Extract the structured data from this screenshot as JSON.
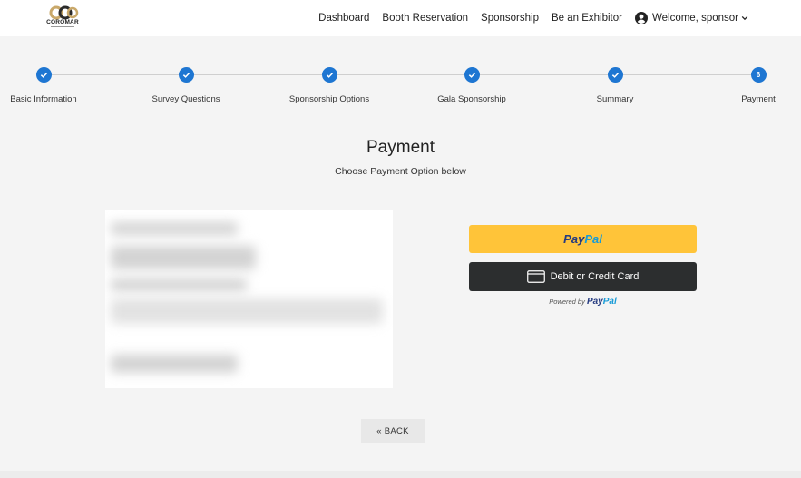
{
  "brand": {
    "name": "COROMAR",
    "logo_colors": {
      "ring1": "#c9a86a",
      "ring2": "#2b2b2b"
    }
  },
  "nav": {
    "items": [
      "Dashboard",
      "Booth Reservation",
      "Sponsorship",
      "Be an Exhibitor"
    ],
    "user_label": "Welcome, sponsor",
    "user_icon": "account-circle-icon",
    "menu_icon": "chevron-down-icon"
  },
  "stepper": {
    "steps": [
      {
        "label": "Basic Information",
        "status": "complete"
      },
      {
        "label": "Survey Questions",
        "status": "complete"
      },
      {
        "label": "Sponsorship Options",
        "status": "complete"
      },
      {
        "label": "Gala Sponsorship",
        "status": "complete"
      },
      {
        "label": "Summary",
        "status": "complete"
      },
      {
        "label": "Payment",
        "status": "current",
        "number": "6"
      }
    ],
    "accent_color": "#1e76d2"
  },
  "page": {
    "title": "Payment",
    "subtitle": "Choose Payment Option below"
  },
  "payment": {
    "paypal_part1": "Pay",
    "paypal_part2": "Pal",
    "card_label": "Debit or Credit Card",
    "card_icon": "credit-card-icon",
    "powered_prefix": "Powered by",
    "powered_brand_part1": "Pay",
    "powered_brand_part2": "Pal",
    "paypal_button_color": "#ffc439",
    "card_button_color": "#2c2e2f"
  },
  "actions": {
    "back_label": "« BACK"
  }
}
